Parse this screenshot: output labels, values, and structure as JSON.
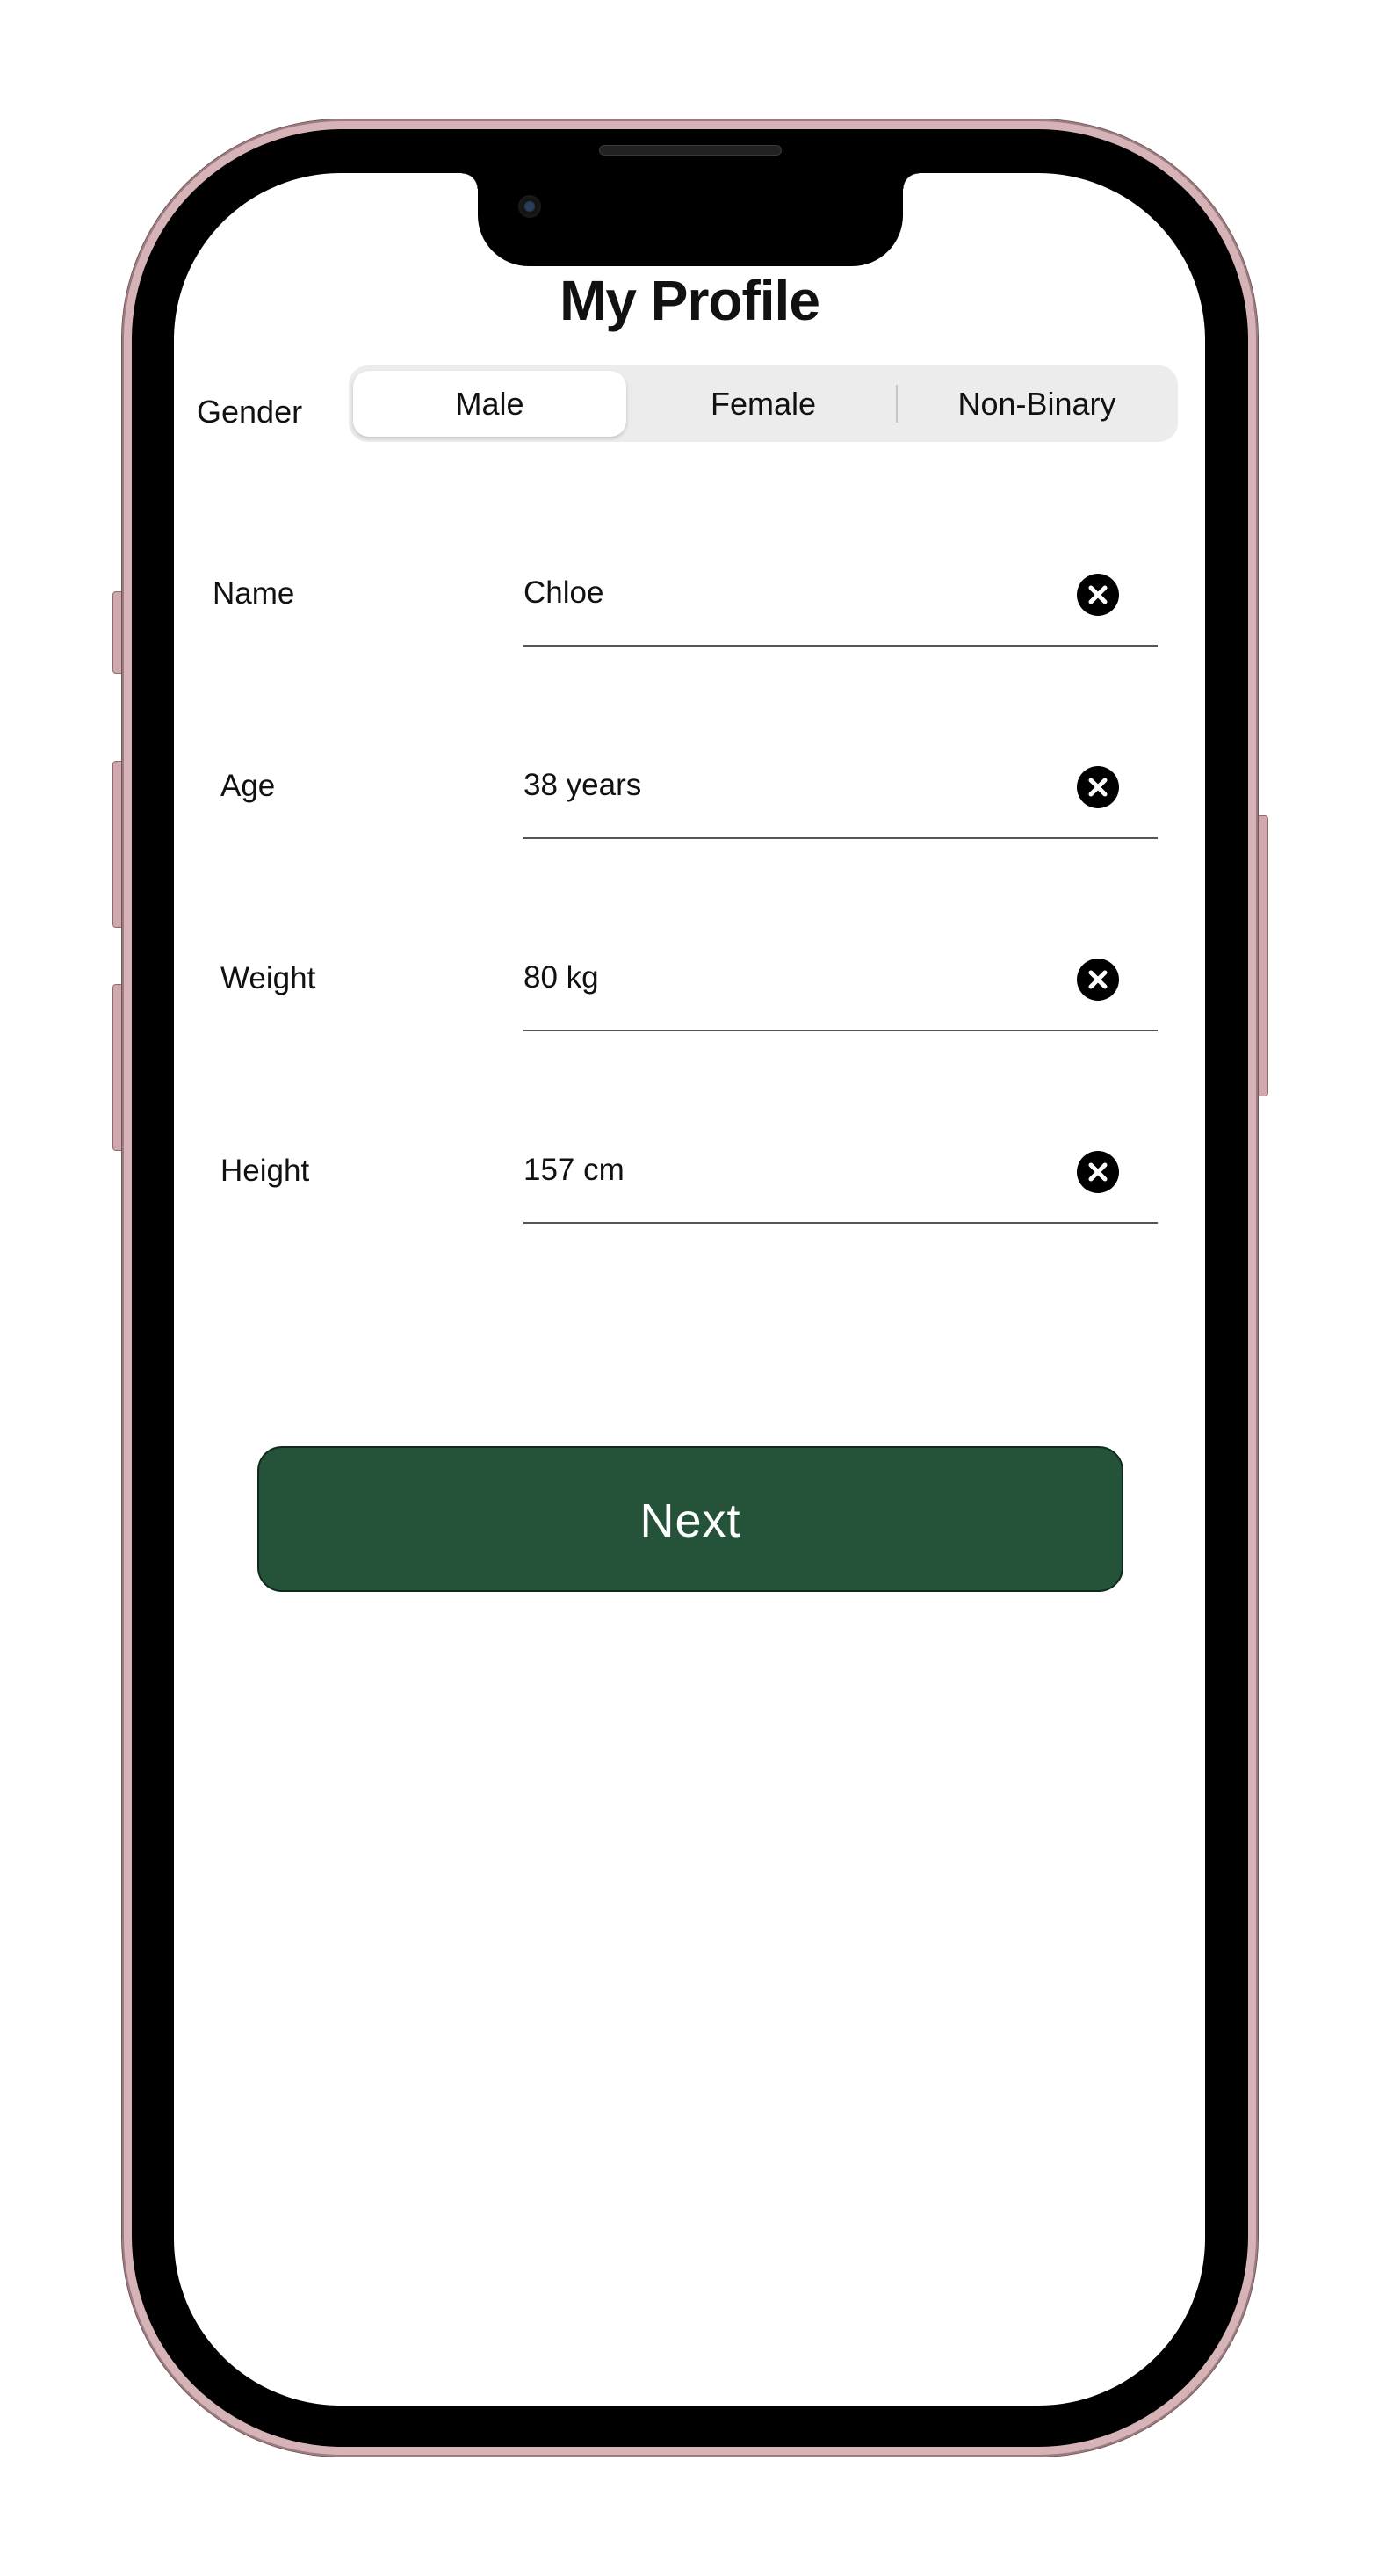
{
  "page": {
    "title": "My Profile"
  },
  "gender": {
    "label": "Gender",
    "options": [
      "Male",
      "Female",
      "Non-Binary"
    ],
    "selected": "Male"
  },
  "fields": [
    {
      "label": "Name",
      "value": "Chloe",
      "clear_icon": "close-circle-icon"
    },
    {
      "label": "Age",
      "value": "38 years",
      "clear_icon": "close-circle-icon"
    },
    {
      "label": "Weight",
      "value": "80 kg",
      "clear_icon": "close-circle-icon"
    },
    {
      "label": "Height",
      "value": "157 cm",
      "clear_icon": "close-circle-icon"
    }
  ],
  "actions": {
    "next_label": "Next"
  },
  "colors": {
    "primary_button": "#24533a",
    "segment_background": "#ececec",
    "phone_frame": "#d5b3b7"
  }
}
